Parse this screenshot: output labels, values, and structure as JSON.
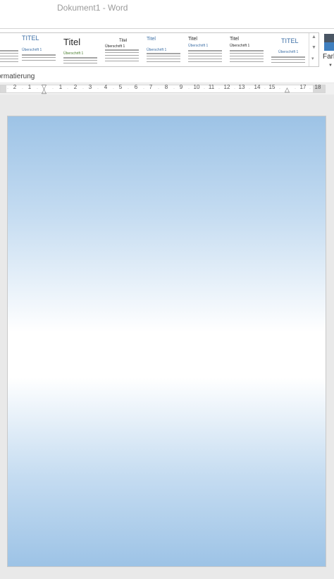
{
  "window": {
    "title": "Dokument1 - Word"
  },
  "ribbon": {
    "styles": [
      {
        "name": "TITEL",
        "heading": "Überschrift 1",
        "title_color": "#3b6ea5",
        "heading_color": "#3b6ea5"
      },
      {
        "name": "Titel",
        "heading": "Überschrift 1",
        "title_color": "#262626",
        "heading_color": "#4a7f2e"
      },
      {
        "name": "Titel",
        "heading": "Überschrift 1",
        "title_color": "#262626",
        "heading_color": "#262626"
      },
      {
        "name": "Titel",
        "heading": "Überschrift 1",
        "title_color": "#3b6ea5",
        "heading_color": "#3b6ea5"
      },
      {
        "name": "Titel",
        "heading": "Überschrift 1",
        "title_color": "#262626",
        "heading_color": "#3b6ea5"
      },
      {
        "name": "Titel",
        "heading": "Überschrift 1",
        "title_color": "#262626",
        "heading_color": "#262626"
      },
      {
        "name": "TITEL",
        "heading": "Überschrift 1",
        "title_color": "#3b6ea5",
        "heading_color": "#3b6ea5"
      }
    ],
    "colors_label": "Farb",
    "group_label": "ormatierung",
    "accent_dark": "#4a5664",
    "accent_blue": "#3f7fbf"
  },
  "ruler": {
    "numbers": [
      "2",
      "1",
      "1",
      "2",
      "3",
      "4",
      "5",
      "6",
      "7",
      "8",
      "9",
      "10",
      "11",
      "12",
      "13",
      "14",
      "15",
      "17",
      "18"
    ]
  },
  "document": {
    "page_gradient": [
      "#9dc3e6",
      "#ffffff",
      "#9dc3e6"
    ]
  }
}
